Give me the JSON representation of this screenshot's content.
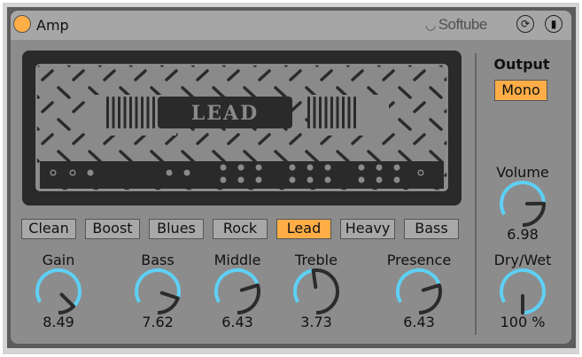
{
  "header": {
    "title": "Amp",
    "brand": "Softube",
    "power_on": true
  },
  "amp_display": {
    "model_label": "LEAD"
  },
  "presets": [
    {
      "label": "Clean",
      "active": false
    },
    {
      "label": "Boost",
      "active": false
    },
    {
      "label": "Blues",
      "active": false
    },
    {
      "label": "Rock",
      "active": false
    },
    {
      "label": "Lead",
      "active": true
    },
    {
      "label": "Heavy",
      "active": false
    },
    {
      "label": "Bass",
      "active": false
    }
  ],
  "knobs": [
    {
      "id": "gain",
      "label": "Gain",
      "value": "8.49",
      "fraction": 0.849
    },
    {
      "id": "bass",
      "label": "Bass",
      "value": "7.62",
      "fraction": 0.762
    },
    {
      "id": "middle",
      "label": "Middle",
      "value": "6.43",
      "fraction": 0.643
    },
    {
      "id": "treble",
      "label": "Treble",
      "value": "3.73",
      "fraction": 0.373
    },
    {
      "id": "presence",
      "label": "Presence",
      "value": "6.43",
      "fraction": 0.643
    }
  ],
  "output": {
    "label": "Output",
    "mode": "Mono",
    "volume": {
      "label": "Volume",
      "value": "6.98",
      "fraction": 0.698
    },
    "drywet": {
      "label": "Dry/Wet",
      "value": "100 %",
      "fraction": 1.0
    }
  },
  "colors": {
    "accent": "#ffad47",
    "arc_active": "#5ed0f5",
    "arc_inactive": "#2b2b2b"
  }
}
